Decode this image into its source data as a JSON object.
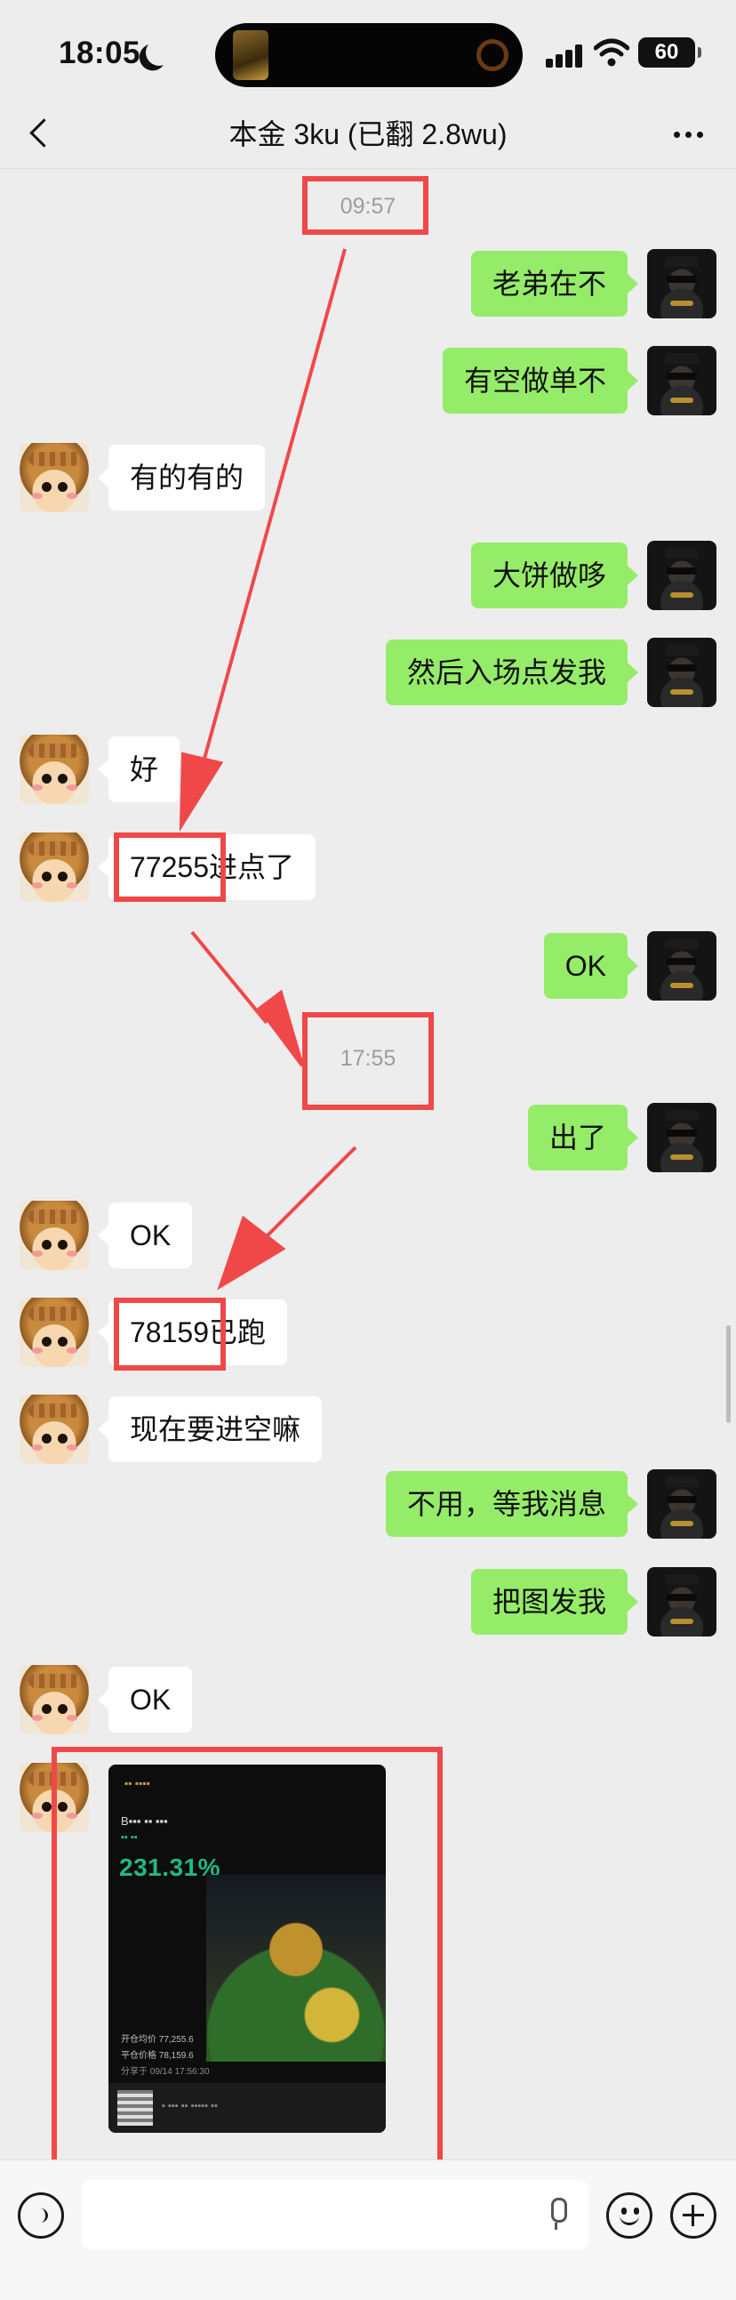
{
  "status_bar": {
    "time": "18:05",
    "battery": "60"
  },
  "nav": {
    "title": "本金 3ku (已翻 2.8wu)"
  },
  "timestamps": [
    "09:57",
    "17:55"
  ],
  "messages": [
    {
      "from": "me",
      "text": "老弟在不"
    },
    {
      "from": "me",
      "text": "有空做单不"
    },
    {
      "from": "other",
      "text": "有的有的"
    },
    {
      "from": "me",
      "text": "大饼做哆"
    },
    {
      "from": "me",
      "text": "然后入场点发我"
    },
    {
      "from": "other",
      "text": "好"
    },
    {
      "from": "other",
      "text": "77255进点了"
    },
    {
      "from": "me",
      "text": "OK"
    },
    {
      "from": "me",
      "text": "出了"
    },
    {
      "from": "other",
      "text": "OK"
    },
    {
      "from": "other",
      "text": "78159已跑"
    },
    {
      "from": "other",
      "text": "现在要进空嘛"
    },
    {
      "from": "me",
      "text": "不用，等我消息"
    },
    {
      "from": "me",
      "text": "把图发我"
    },
    {
      "from": "other",
      "text": "OK"
    }
  ],
  "image_message": {
    "pnl_percent": "231.31%",
    "open_price_label": "开仓均价",
    "open_price": "77,255.6",
    "close_price_label": "平仓价格",
    "close_price": "78,159.6",
    "share_time": "分享于 09/14 17:56:30"
  },
  "colors": {
    "sent_bubble": "#95ec69",
    "received_bubble": "#ffffff",
    "highlight": "#f04848",
    "profit_green": "#1fb983"
  },
  "icons": [
    "back-icon",
    "more-icon",
    "voice-icon",
    "mic-icon",
    "emoji-icon",
    "plus-icon"
  ]
}
